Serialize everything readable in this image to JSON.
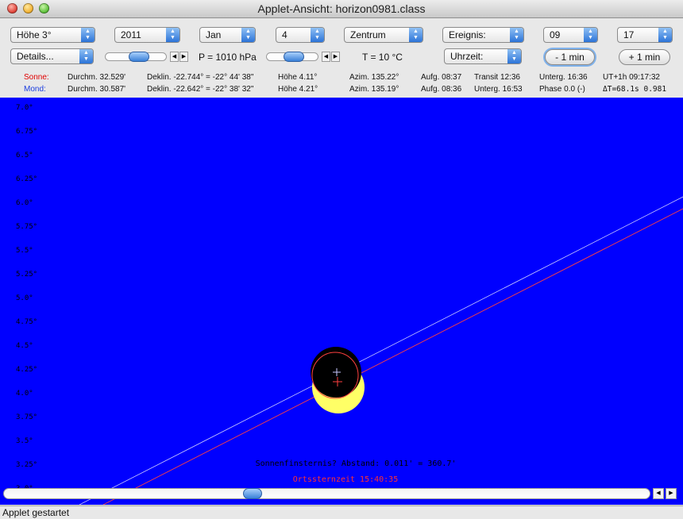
{
  "window": {
    "title": "Applet-Ansicht: horizon0981.class"
  },
  "controls": {
    "hoehe": "Höhe 3°",
    "year": "2011",
    "month": "Jan",
    "day": "4",
    "center": "Zentrum",
    "event": "Ereignis:",
    "hour": "09",
    "minute": "17",
    "details": "Details...",
    "pressure": "P = 1010 hPa",
    "temperature": "T = 10 °C",
    "time_mode": "Uhrzeit:",
    "minus_min": "- 1 min",
    "plus_min": "+ 1 min"
  },
  "sun": {
    "label": "Sonne:",
    "diameter": "Durchm. 32.529'",
    "declination": "Deklin. -22.744° = -22° 44' 38\"",
    "altitude": "Höhe 4.11°",
    "azimuth": "Azim. 135.22°",
    "rise": "Aufg. 08:37",
    "transit": "Transit 12:36",
    "set": "Unterg. 16:36",
    "ut": "UT+1h  09:17:32"
  },
  "moon": {
    "label": "Mond:",
    "diameter": "Durchm. 30.587'",
    "declination": "Deklin. -22.642° = -22° 38' 32\"",
    "altitude": "Höhe 4.21°",
    "azimuth": "Azim. 135.19°",
    "rise": "Aufg. 08:36",
    "set": "Unterg. 16:53",
    "phase": "Phase 0.0 (-)",
    "delta_t": "ΔT=68.1s  0.981"
  },
  "canvas": {
    "axis_labels": [
      "7.0°",
      "6.75°",
      "6.5°",
      "6.25°",
      "6.0°",
      "5.75°",
      "5.5°",
      "5.25°",
      "5.0°",
      "4.75°",
      "4.5°",
      "4.25°",
      "4.0°",
      "3.75°",
      "3.5°",
      "3.25°",
      "3.0°"
    ],
    "eclipse_text": "Sonnenfinsternis? Abstand: 0.011' = 360.7'",
    "sidereal_text": "Ortssternzeit 15:40:35",
    "colors": {
      "sky": "#0000ff",
      "sun": "#ffff66",
      "moon": "#000000",
      "sun_path": "#ff4040",
      "moon_path": "#c8c8ff"
    },
    "horizontal_scroll": 0.37
  },
  "status": {
    "text": "Applet gestartet"
  }
}
